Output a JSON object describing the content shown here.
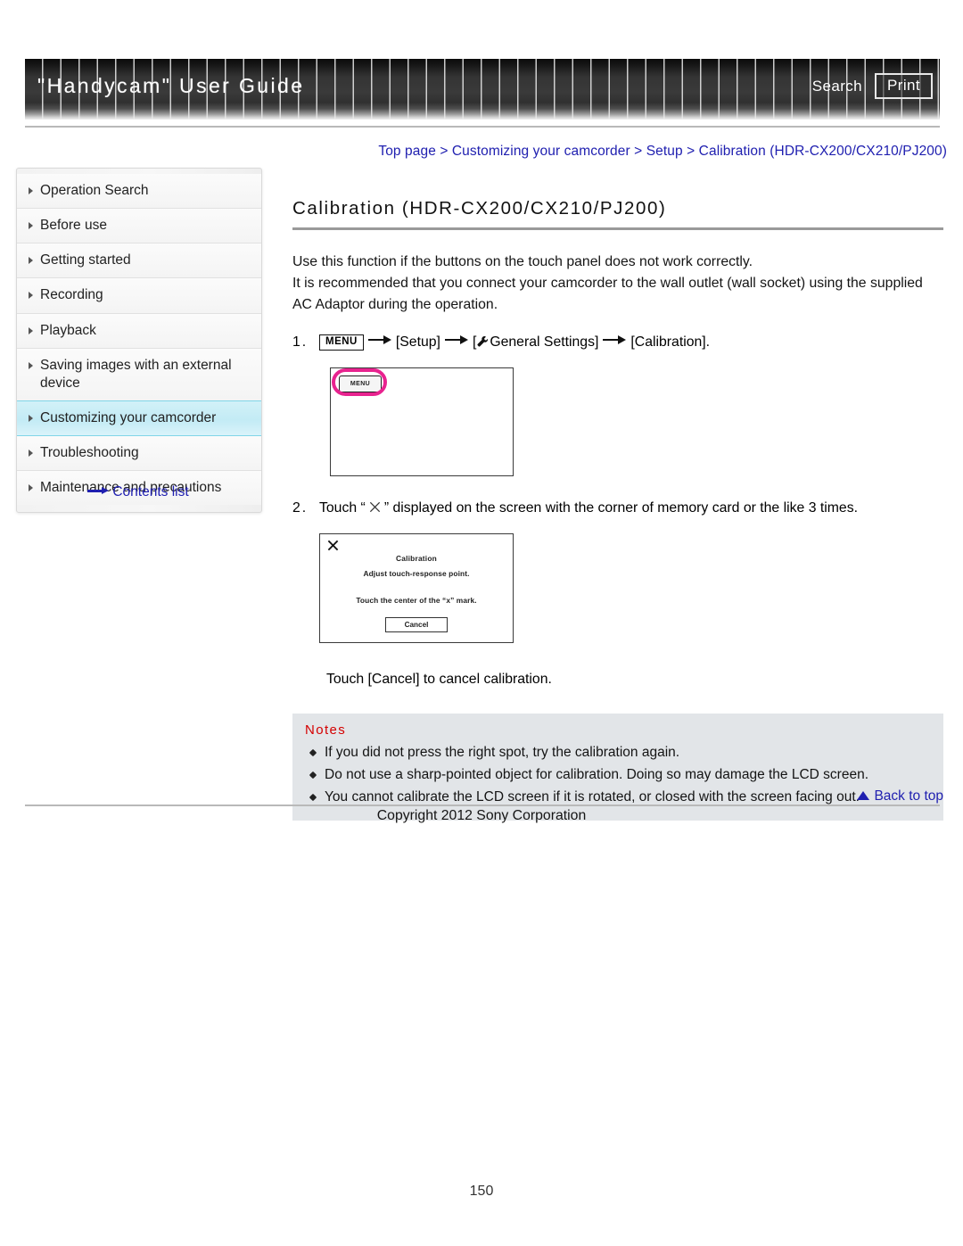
{
  "header": {
    "title": "\"Handycam\" User Guide",
    "search_label": "Search",
    "print_label": "Print"
  },
  "breadcrumb": {
    "text": "Top page > Customizing your camcorder > Setup > Calibration (HDR-CX200/CX210/PJ200)"
  },
  "sidebar": {
    "items": [
      {
        "label": "Operation Search"
      },
      {
        "label": "Before use"
      },
      {
        "label": "Getting started"
      },
      {
        "label": "Recording"
      },
      {
        "label": "Playback"
      },
      {
        "label": "Saving images with an external device"
      },
      {
        "label": "Customizing your camcorder"
      },
      {
        "label": "Troubleshooting"
      },
      {
        "label": "Maintenance and precautions"
      }
    ],
    "active_index": 6,
    "contents_link": "Contents list"
  },
  "main": {
    "title": "Calibration (HDR-CX200/CX210/PJ200)",
    "intro_line1": "Use this function if the buttons on the touch panel does not work correctly.",
    "intro_line2": "It is recommended that you connect your camcorder to the wall outlet (wall socket) using the supplied AC Adaptor during the operation.",
    "step1": {
      "number": "1.",
      "menu_chip": "MENU",
      "setup_label": "[Setup]",
      "general_settings_label": "General Settings]",
      "general_settings_open": "[",
      "calibration_label": "[Calibration]."
    },
    "figure1": {
      "menu_button_label": "MENU"
    },
    "step2": {
      "number": "2.",
      "text_before": "Touch “",
      "text_after": "” displayed on the screen with the corner of memory card or the like 3 times."
    },
    "figure2": {
      "title": "Calibration",
      "subtitle": "Adjust touch-response point.",
      "instruction": "Touch the center of the “x” mark.",
      "cancel_label": "Cancel"
    },
    "cancel_note": "Touch [Cancel] to cancel calibration.",
    "notes": {
      "heading": "Notes",
      "items": [
        "If you did not press the right spot, try the calibration again.",
        "Do not use a sharp-pointed object for calibration. Doing so may damage the LCD screen.",
        "You cannot calibrate the LCD screen if it is rotated, or closed with the screen facing out."
      ]
    }
  },
  "footer": {
    "back_to_top": "Back to top",
    "copyright": "Copyright 2012 Sony Corporation",
    "page_number": "150"
  },
  "colors": {
    "link": "#2020b0",
    "notes_heading": "#d40000",
    "notes_bg": "#e2e5e8",
    "sidebar_active": "#c3ebf5",
    "highlight_ring": "#e8238f"
  }
}
